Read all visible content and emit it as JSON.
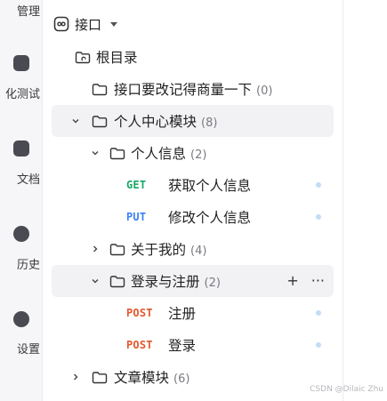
{
  "sidebar": {
    "items": [
      {
        "label": "管理"
      },
      {
        "label": "化测试"
      },
      {
        "label": "文档"
      },
      {
        "label": "历史"
      },
      {
        "label": "设置"
      }
    ]
  },
  "header": {
    "title": "接口"
  },
  "tree": {
    "root": {
      "label": "根目录"
    },
    "folder_rename": {
      "label": "接口要改记得商量一下",
      "count": "(0)"
    },
    "folder_personal_center": {
      "label": "个人中心模块",
      "count": "(8)"
    },
    "folder_personal_info": {
      "label": "个人信息",
      "count": "(2)"
    },
    "ep_get_info": {
      "method": "GET",
      "label": "获取个人信息"
    },
    "ep_put_info": {
      "method": "PUT",
      "label": "修改个人信息"
    },
    "folder_about_me": {
      "label": "关于我的",
      "count": "(4)"
    },
    "folder_login_register": {
      "label": "登录与注册",
      "count": "(2)",
      "add_label": "+",
      "more_label": "···"
    },
    "ep_register": {
      "method": "POST",
      "label": "注册"
    },
    "ep_login": {
      "method": "POST",
      "label": "登录"
    },
    "folder_article": {
      "label": "文章模块",
      "count": "(6)"
    }
  },
  "colors": {
    "get": "#1aa765",
    "put": "#3b82f6",
    "post": "#e2582f",
    "highlight": "#f2f2f5",
    "dot": "#c4dbf7"
  },
  "watermark": "CSDN @Dilaic Zhu"
}
